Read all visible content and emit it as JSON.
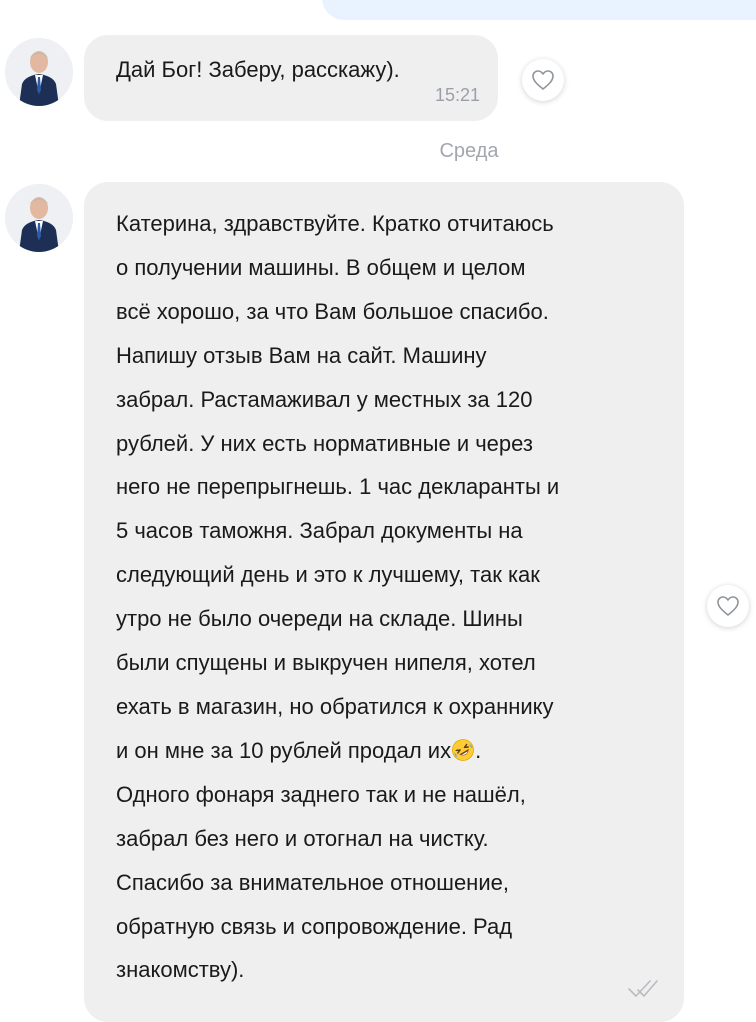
{
  "messages": [
    {
      "text": "Дай Бог!  Заберу, расскажу).",
      "time": "15:21"
    }
  ],
  "separator": "Среда",
  "long_message": {
    "lines": [
      "Катерина, здравствуйте. Кратко отчитаюсь",
      "о получении машины. В общем и целом",
      "всё хорошо, за что Вам большое спасибо.",
      "Напишу отзыв Вам на сайт. Машину",
      "забрал. Растамаживал у местных за 120",
      "рублей. У них есть нормативные и через",
      "него не перепрыгнешь. 1 час декларанты и",
      "5 часов таможня. Забрал документы на",
      "следующий день и это к лучшему, так как",
      "утро не было очереди на складе. Шины",
      "были спущены и выкручен нипеля, хотел",
      "ехать в магазин, но обратился к охраннику",
      "и он мне за 10 рублей продал их",
      ".",
      "Одного фонаря заднего так и не нашёл,",
      "забрал без него и отогнал на чистку.",
      "Спасибо за внимательное отношение,",
      "обратную связь и сопровождение. Рад",
      "знакомству)."
    ],
    "emoji": "rolling-on-the-floor-laughing-emoji"
  },
  "icons": {
    "like": "heart-icon",
    "avatar": "person-in-suit-avatar",
    "read_mark": "read-receipt-icon"
  },
  "colors": {
    "bubble_incoming": "#efefef",
    "bubble_outgoing": "#e8f3ff",
    "meta_text": "#9aa0a6"
  }
}
